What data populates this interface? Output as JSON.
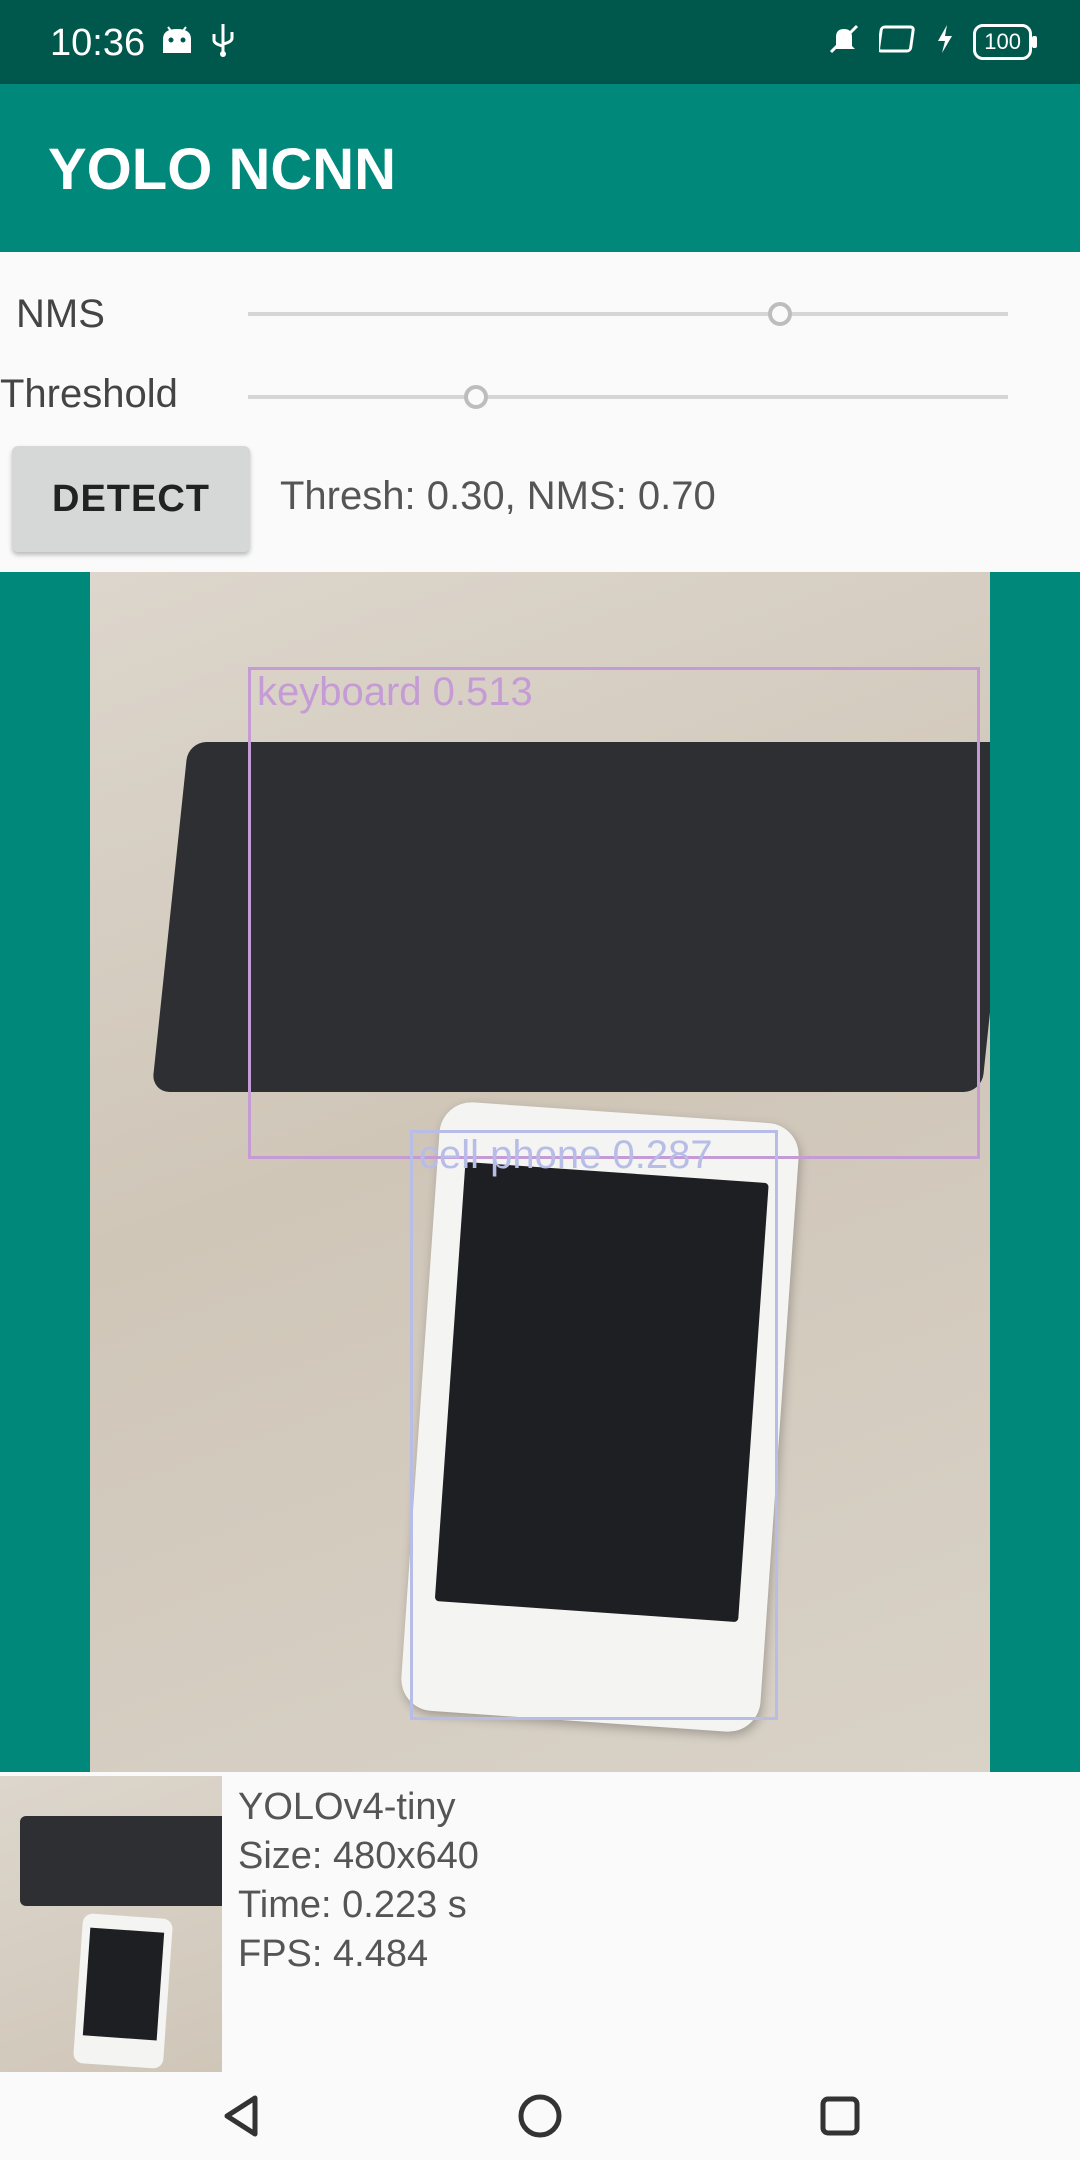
{
  "status_bar": {
    "time": "10:36",
    "battery": "100",
    "icons": [
      "android-icon",
      "usb-icon",
      "mute-icon",
      "cast-icon",
      "charging-icon",
      "battery-icon"
    ]
  },
  "app_bar": {
    "title": "YOLO NCNN"
  },
  "controls": {
    "nms_label": "NMS",
    "threshold_label": "Threshold",
    "nms_slider_value": 0.7,
    "threshold_slider_value": 0.3,
    "detect_button": "DETECT",
    "status_text": "Thresh: 0.30, NMS: 0.70"
  },
  "detections": [
    {
      "label": "keyboard 0.513",
      "color": "#c59bd6"
    },
    {
      "label": "cell phone 0.287",
      "color": "#b8bde8"
    }
  ],
  "info": {
    "model": "YOLOv4-tiny",
    "size": "Size: 480x640",
    "time": "Time: 0.223 s",
    "fps": "FPS: 4.484"
  },
  "colors": {
    "primary": "#00897b",
    "primary_dark": "#00574b"
  }
}
